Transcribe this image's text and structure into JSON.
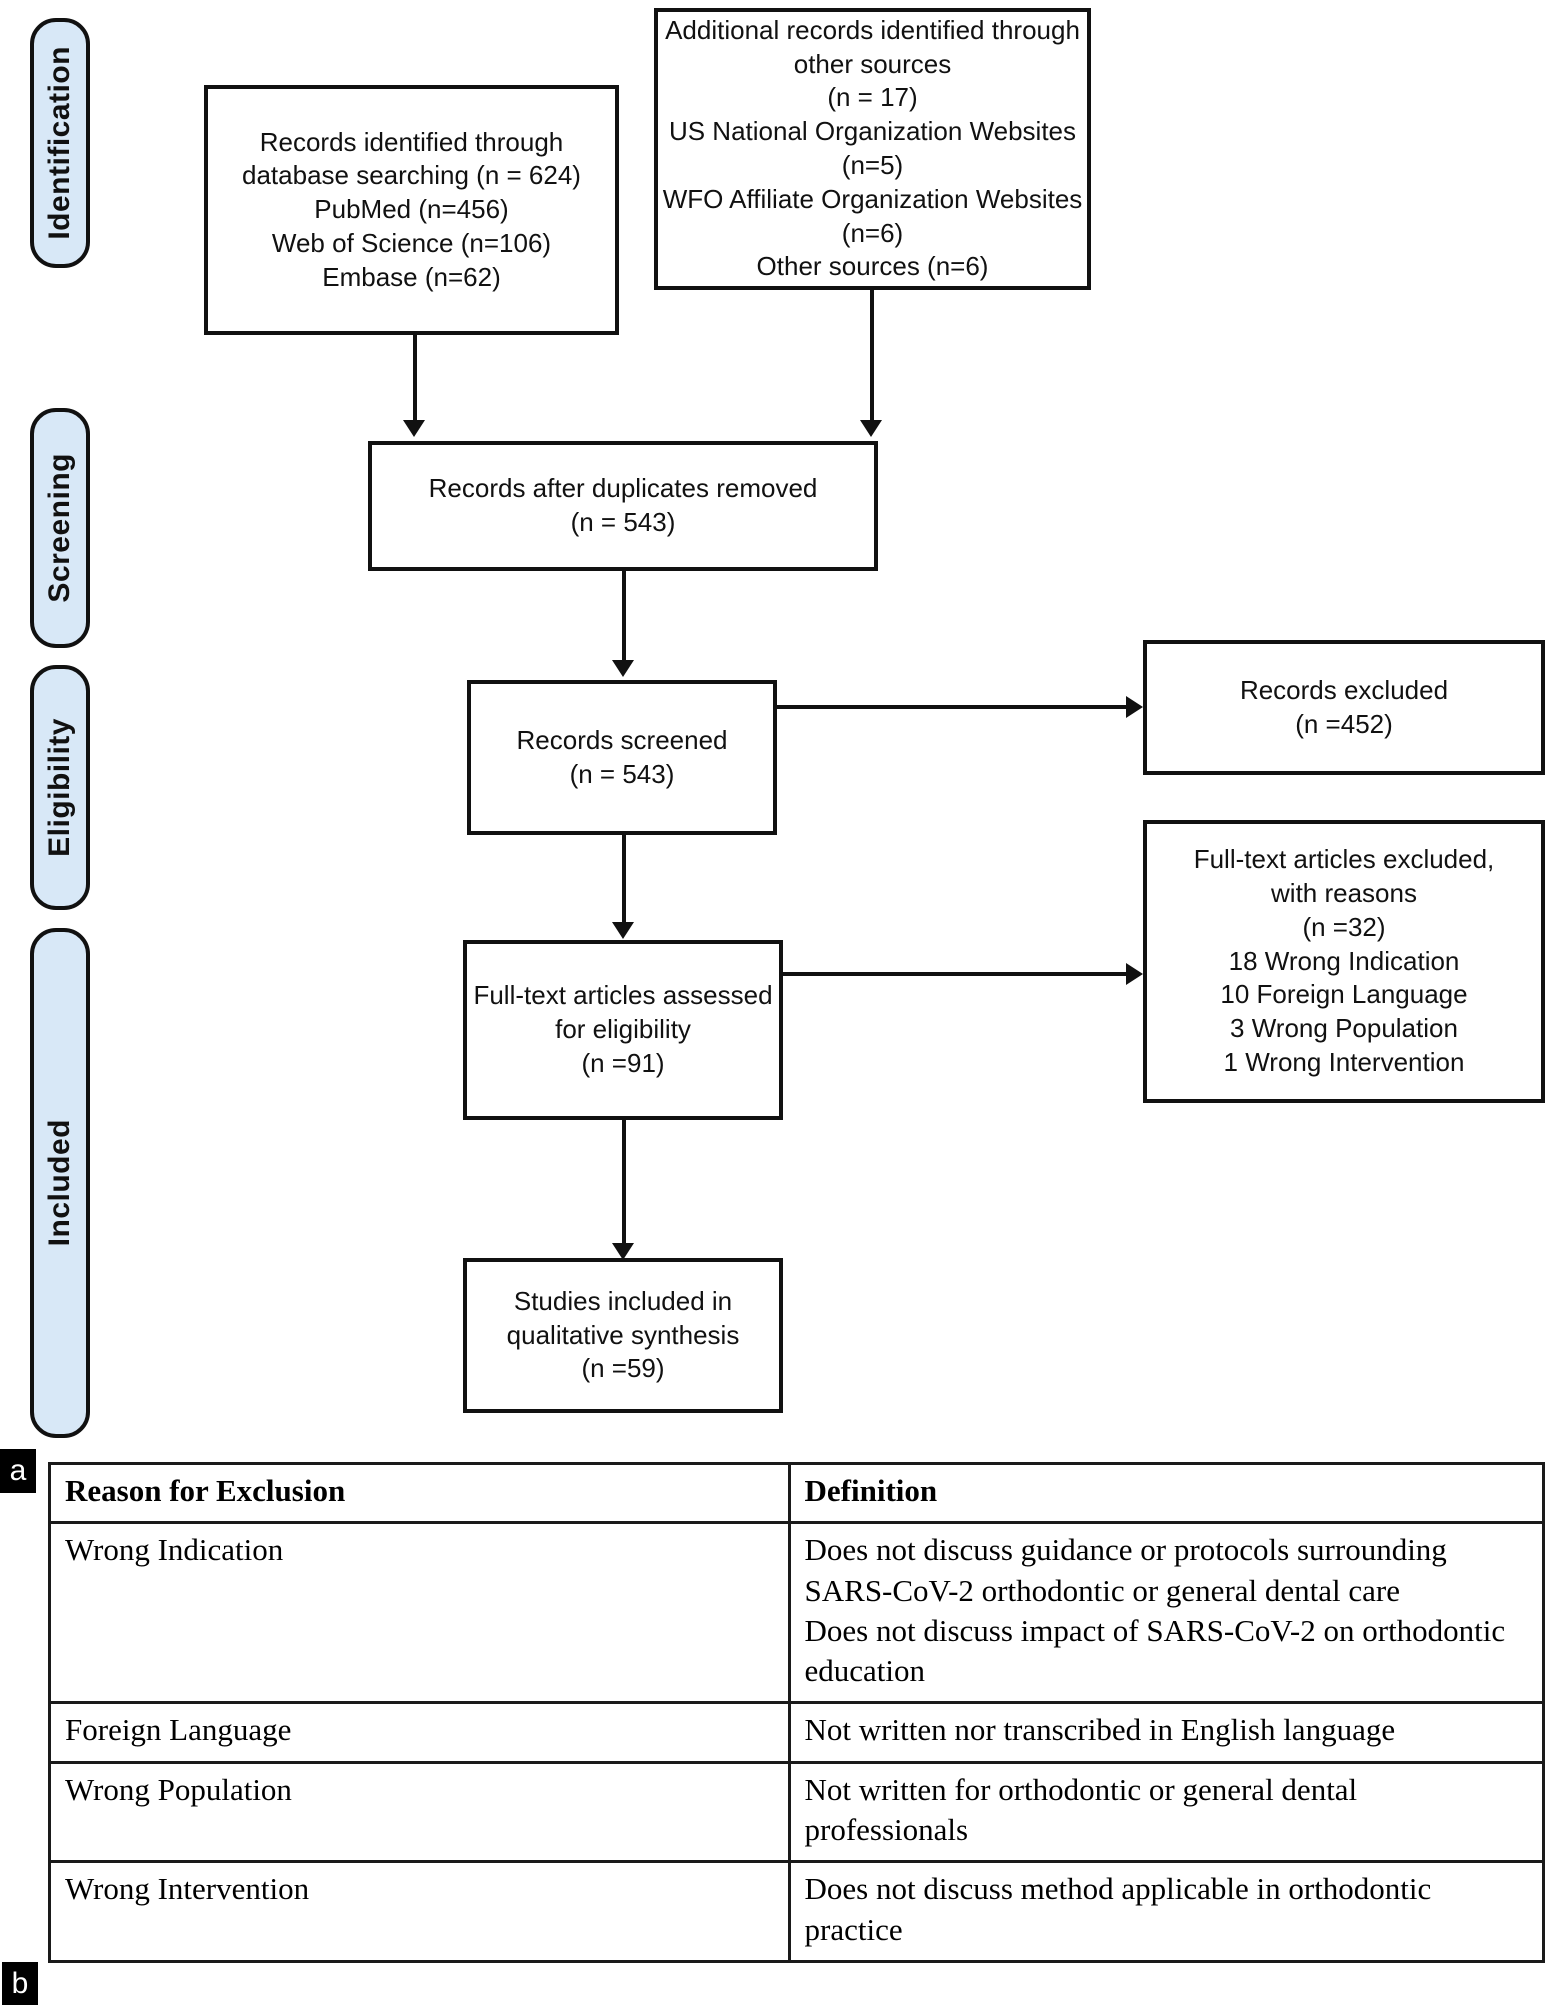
{
  "diagram": {
    "stages": [
      {
        "label": "Identification"
      },
      {
        "label": "Screening"
      },
      {
        "label": "Eligibility"
      },
      {
        "label": "Included"
      }
    ],
    "boxes": {
      "database_search": {
        "lines": [
          "Records identified through",
          "database searching (n = 624)",
          "PubMed (n=456)",
          "Web of Science (n=106)",
          "Embase (n=62)"
        ]
      },
      "other_sources": {
        "lines": [
          "Additional records identified through",
          "other sources",
          "(n = 17)",
          "US National Organization Websites",
          "(n=5)",
          "WFO Affiliate Organization Websites",
          "(n=6)",
          "Other sources (n=6)"
        ]
      },
      "duplicates_removed": {
        "lines": [
          "Records after duplicates removed",
          "(n = 543)"
        ]
      },
      "records_screened": {
        "lines": [
          "Records screened",
          "(n = 543)"
        ]
      },
      "records_excluded": {
        "lines": [
          "Records excluded",
          "(n =452)"
        ]
      },
      "fulltext_assessed": {
        "lines": [
          "Full-text articles assessed",
          "for eligibility",
          "(n =91)"
        ]
      },
      "fulltext_excluded": {
        "lines": [
          "Full-text articles excluded,",
          "with reasons",
          "(n =32)",
          "18 Wrong Indication",
          "10 Foreign Language",
          "3 Wrong Population",
          "1 Wrong Intervention"
        ]
      },
      "studies_included": {
        "lines": [
          "Studies included in",
          "qualitative synthesis",
          "(n =59)"
        ]
      }
    }
  },
  "panels": {
    "a": "a",
    "b": "b"
  },
  "exclusion_table": {
    "headers": [
      "Reason for Exclusion",
      "Definition"
    ],
    "rows": [
      {
        "reason": "Wrong Indication",
        "definition": [
          "Does not discuss guidance or protocols surrounding SARS-CoV-2 orthodontic or general dental care",
          "Does not discuss impact of SARS-CoV-2 on orthodontic education"
        ]
      },
      {
        "reason": "Foreign Language",
        "definition": [
          "Not written nor transcribed in English language"
        ]
      },
      {
        "reason": "Wrong Population",
        "definition": [
          "Not written for orthodontic or general dental professionals"
        ]
      },
      {
        "reason": "Wrong Intervention",
        "definition": [
          "Does not discuss method applicable in orthodontic practice"
        ]
      }
    ]
  },
  "colors": {
    "stage_fill": "#d8e8f7",
    "stroke": "#111111",
    "badge_bg": "#000000"
  }
}
